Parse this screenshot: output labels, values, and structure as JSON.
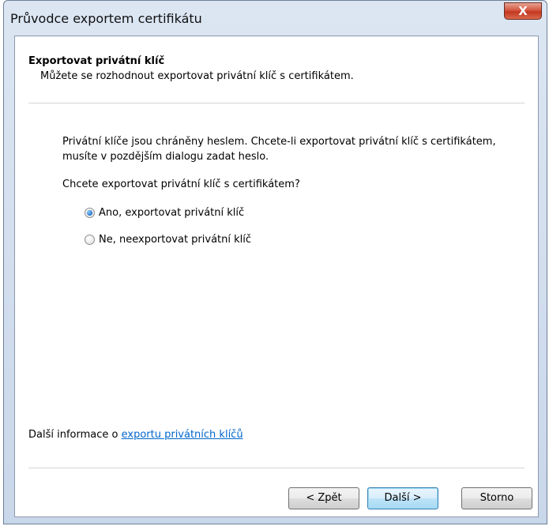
{
  "window": {
    "title": "Průvodce exportem certifikátu",
    "close_label": "X"
  },
  "header": {
    "title": "Exportovat privátní klíč",
    "subtitle": "Můžete se rozhodnout exportovat privátní klíč s certifikátem."
  },
  "body": {
    "description_line1": "Privátní klíče jsou chráněny heslem. Chcete-li exportovat privátní klíč s certifikátem,",
    "description_line2": "musíte v pozdějším dialogu zadat heslo.",
    "question": "Chcete exportovat privátní klíč s certifikátem?",
    "options": [
      {
        "label": "Ano, exportovat privátní klíč",
        "selected": true
      },
      {
        "label": "Ne, neexportovat privátní klíč",
        "selected": false
      }
    ]
  },
  "footer": {
    "more_info_prefix": "Další informace o",
    "more_info_link": "exportu privátních klíčů"
  },
  "buttons": {
    "back": "< Zpět",
    "next": "Další >",
    "cancel": "Storno"
  }
}
